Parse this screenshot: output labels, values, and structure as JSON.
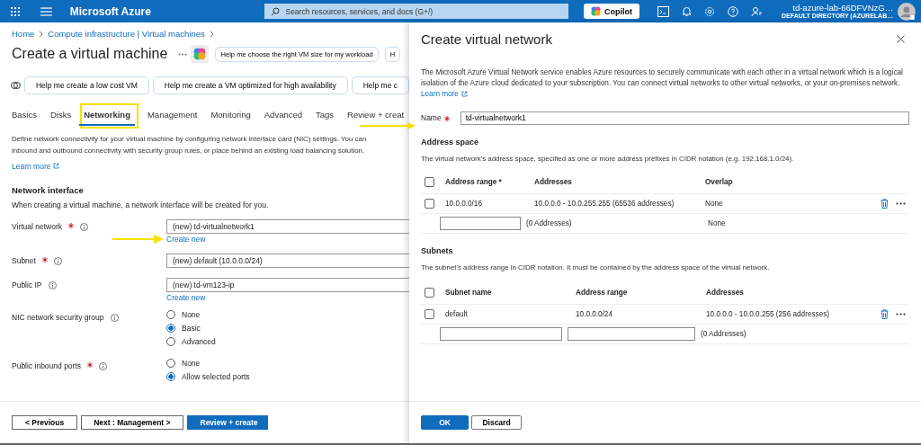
{
  "topbar": {
    "brand": "Microsoft Azure",
    "search": {
      "placeholder": "Search resources, services, and docs (G+/)"
    },
    "copilot": "Copilot",
    "user": "td-azure-lab-66DFVNzG…",
    "directory": "DEFAULT DIRECTORY (AZURELAB…"
  },
  "page": {
    "breadcrumb": [
      "Home",
      "Compute infrastructure | Virtual machines"
    ],
    "title": "Create a virtual machine",
    "prompt_chips": [
      "Help me choose the right VM size for my workload",
      "H"
    ],
    "suggestion_chips": [
      "Help me create a low cost VM",
      "Help me create a VM optimized for high availability",
      "Help me c"
    ],
    "tabs": [
      {
        "label": "Basics",
        "selected": false,
        "highlighted": false
      },
      {
        "label": "Disks",
        "selected": false,
        "highlighted": false
      },
      {
        "label": "Networking",
        "selected": true,
        "highlighted": true
      },
      {
        "label": "Management",
        "selected": false,
        "highlighted": false
      },
      {
        "label": "Monitoring",
        "selected": false,
        "highlighted": false
      },
      {
        "label": "Advanced",
        "selected": false,
        "highlighted": false
      },
      {
        "label": "Tags",
        "selected": false,
        "highlighted": false
      },
      {
        "label": "Review + creat",
        "selected": false,
        "highlighted": false
      }
    ],
    "description": [
      "Define network connectivity for your virtual machine by configuring network interface card (NIC) settings. You can",
      "inbound and outbound connectivity with security group rules, or place behind an existing load balancing solution."
    ],
    "learn_more": "Learn more",
    "section": "Network interface",
    "section_note": "When creating a virtual machine, a network interface will be created for you.",
    "fields": [
      {
        "kind": "select",
        "label": "Virtual network",
        "required": true,
        "value": "(new) td-virtualnetwork1",
        "link": "Create new"
      },
      {
        "kind": "select",
        "label": "Subnet",
        "required": true,
        "value": "(new) default (10.0.0.0/24)"
      },
      {
        "kind": "select",
        "label": "Public IP",
        "required": false,
        "value": "(new) td-vm123-ip",
        "link": "Create new"
      },
      {
        "kind": "radio",
        "label": "NIC network security group",
        "required": false,
        "options": [
          {
            "label": "None",
            "selected": false
          },
          {
            "label": "Basic",
            "selected": true
          },
          {
            "label": "Advanced",
            "selected": false
          }
        ]
      },
      {
        "kind": "radio",
        "label": "Public inbound ports",
        "required": true,
        "options": [
          {
            "label": "None",
            "selected": false
          },
          {
            "label": "Allow selected ports",
            "selected": true
          }
        ]
      }
    ],
    "footer_buttons": [
      {
        "label": "< Previous",
        "primary": false
      },
      {
        "label": "Next : Management >",
        "primary": false
      },
      {
        "label": "Review + create",
        "primary": true
      }
    ]
  },
  "panel": {
    "title": "Create virtual network",
    "description": "The Microsoft Azure Virtual Network service enables Azure resources to securely communicate with each other in a virtual network which is a logical isolation of the Azure cloud dedicated to your subscription. You can connect virtual networks to other virtual networks, or your on-premises network.",
    "learn_more": "Learn more",
    "name_field": {
      "label": "Name",
      "required": true,
      "value": "td-virtualnetwork1"
    },
    "address_space": {
      "heading": "Address space",
      "note": "The virtual network's address space, specified as one or more address prefixes in CIDR notation (e.g. 192.168.1.0/24).",
      "header_checked": false,
      "columns": [
        "Address range *",
        "Addresses",
        "Overlap"
      ],
      "rows": [
        {
          "checked": false,
          "cells": [
            "10.0.0.0/16",
            "10.0.0.0 - 10.0.255.255 (65536 addresses)",
            "None"
          ]
        }
      ],
      "new_row": [
        "(0 Addresses)",
        "None"
      ]
    },
    "subnets": {
      "heading": "Subnets",
      "note": "The subnet's address range in CIDR notation. It must be contained by the address space of the virtual network.",
      "header_checked": false,
      "columns": [
        "Subnet name",
        "Address range",
        "Addresses"
      ],
      "rows": [
        {
          "checked": false,
          "cells": [
            "default",
            "10.0.0.0/24",
            "10.0.0.0 - 10.0.0.255 (256 addresses)"
          ]
        }
      ],
      "new_row": [
        "(0 Addresses)"
      ]
    },
    "buttons": [
      {
        "label": "OK",
        "primary": true
      },
      {
        "label": "Discard",
        "primary": false
      }
    ]
  }
}
